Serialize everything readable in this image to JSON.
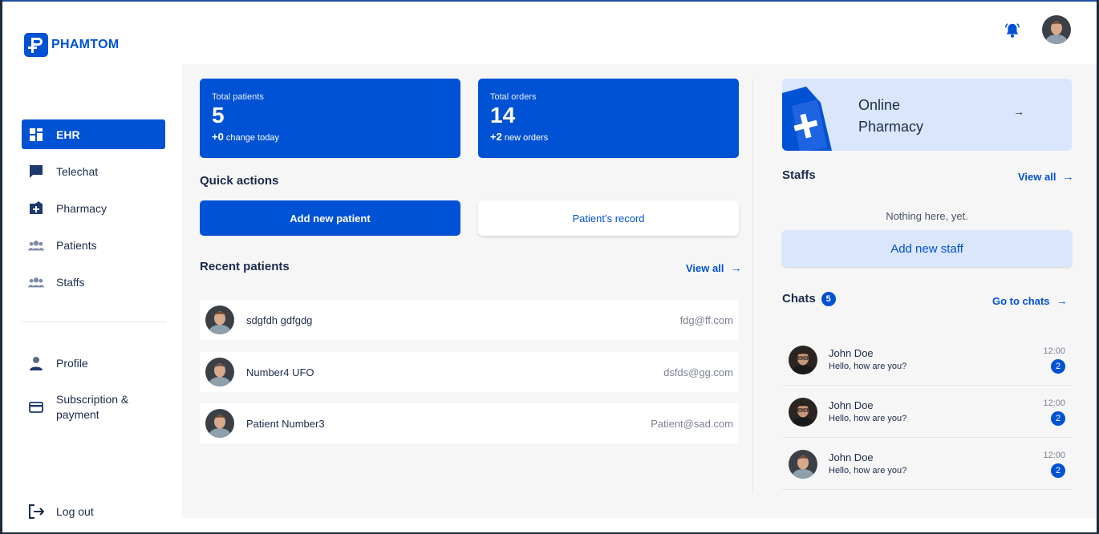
{
  "brand": {
    "name": "PHAMTOM",
    "color": "#0052d4"
  },
  "header": {
    "bell_icon": "bell-icon",
    "avatar": "user-avatar"
  },
  "sidebar": {
    "items": [
      {
        "label": "EHR",
        "icon": "dashboard-icon",
        "active": true
      },
      {
        "label": "Telechat",
        "icon": "chat-icon"
      },
      {
        "label": "Pharmacy",
        "icon": "pharmacy-icon"
      },
      {
        "label": "Patients",
        "icon": "people-icon"
      },
      {
        "label": "Staffs",
        "icon": "people-icon"
      }
    ],
    "bottom_items": [
      {
        "label": "Profile",
        "icon": "person-icon"
      },
      {
        "label": "Subscription & payment",
        "icon": "credit-card-icon"
      }
    ],
    "logout": {
      "label": "Log out",
      "icon": "logout-icon"
    }
  },
  "stats": [
    {
      "label": "Total patients",
      "value": "5",
      "change_value": "+0",
      "change_text": "change today"
    },
    {
      "label": "Total orders",
      "value": "14",
      "change_value": "+2",
      "change_text": "new orders"
    }
  ],
  "quick_actions": {
    "title": "Quick actions",
    "primary": "Add new patient",
    "secondary": "Patient’s record"
  },
  "recent_patients": {
    "title": "Recent patients",
    "view_all": "View all",
    "rows": [
      {
        "name": "sdgfdh gdfgdg",
        "email": "fdg@ff.com"
      },
      {
        "name": "Number4 UFO",
        "email": "dsfds@gg.com"
      },
      {
        "name": "Patient Number3",
        "email": "Patient@sad.com"
      }
    ]
  },
  "online_pharmacy": {
    "line1": "Online",
    "line2": "Pharmacy",
    "arrow": "→"
  },
  "staffs": {
    "title": "Staffs",
    "view_all": "View all",
    "empty": "Nothing here, yet.",
    "add_button": "Add new staff"
  },
  "chats": {
    "title": "Chats",
    "count": "5",
    "go_to": "Go to chats",
    "rows": [
      {
        "name": "John Doe",
        "message": "Hello, how are you?",
        "time": "12:00",
        "unread": "2"
      },
      {
        "name": "John Doe",
        "message": "Hello, how are you?",
        "time": "12:00",
        "unread": "2"
      },
      {
        "name": "John Doe",
        "message": "Hello, how are you?",
        "time": "12:00",
        "unread": "2"
      }
    ]
  },
  "arrow_glyph": "→"
}
